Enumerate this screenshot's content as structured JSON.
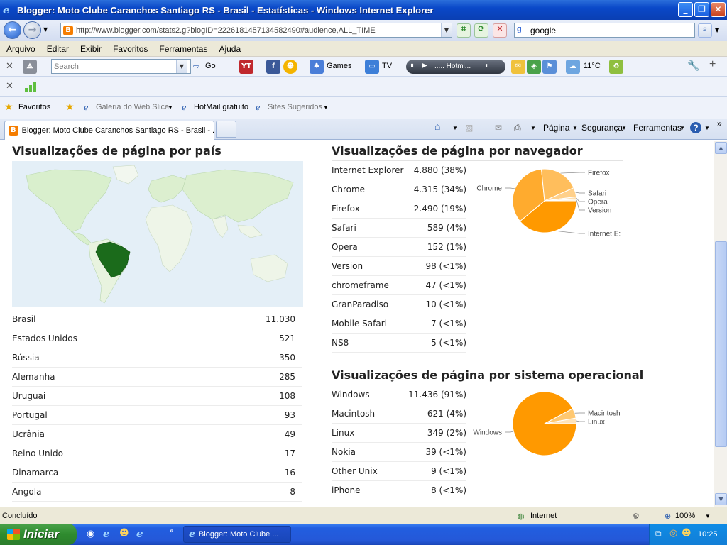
{
  "window": {
    "title": "Blogger: Moto Clube Caranchos Santiago RS - Brasil - Estatísticas - Windows Internet Explorer"
  },
  "address": {
    "url": "http://www.blogger.com/stats2.g?blogID=2226181457134582490#audience,ALL_TIME",
    "search_value": "google"
  },
  "menu": [
    "Arquivo",
    "Editar",
    "Exibir",
    "Favoritos",
    "Ferramentas",
    "Ajuda"
  ],
  "toolbar1": {
    "search_placeholder": "Search",
    "go_label": "Go",
    "games_label": "Games",
    "tv_label": "TV",
    "player_label": "..... Hotmi...",
    "temperature": "11°C"
  },
  "favorites": {
    "favorites_label": "Favoritos",
    "web_slice": "Galeria do Web Slice",
    "hotmail": "HotMail gratuito",
    "suggested": "Sites Sugeridos"
  },
  "tabs": {
    "active_label": "Blogger: Moto Clube Caranchos Santiago RS - Brasil - ..."
  },
  "commands": {
    "page": "Página",
    "security": "Segurança",
    "tools": "Ferramentas"
  },
  "countries": {
    "title": "Visualizações de página por país",
    "rows": [
      {
        "name": "Brasil",
        "value": "11.030"
      },
      {
        "name": "Estados Unidos",
        "value": "521"
      },
      {
        "name": "Rússia",
        "value": "350"
      },
      {
        "name": "Alemanha",
        "value": "285"
      },
      {
        "name": "Uruguai",
        "value": "108"
      },
      {
        "name": "Portugal",
        "value": "93"
      },
      {
        "name": "Ucrânia",
        "value": "49"
      },
      {
        "name": "Reino Unido",
        "value": "17"
      },
      {
        "name": "Dinamarca",
        "value": "16"
      },
      {
        "name": "Angola",
        "value": "8"
      }
    ]
  },
  "browsers": {
    "title": "Visualizações de página por navegador",
    "rows": [
      {
        "name": "Internet Explorer",
        "value": "4.880 (38%)"
      },
      {
        "name": "Chrome",
        "value": "4.315 (34%)"
      },
      {
        "name": "Firefox",
        "value": "2.490 (19%)"
      },
      {
        "name": "Safari",
        "value": "589 (4%)"
      },
      {
        "name": "Opera",
        "value": "152 (1%)"
      },
      {
        "name": "Version",
        "value": "98 (<1%)"
      },
      {
        "name": "chromeframe",
        "value": "47 (<1%)"
      },
      {
        "name": "GranParadiso",
        "value": "10 (<1%)"
      },
      {
        "name": "Mobile Safari",
        "value": "7 (<1%)"
      },
      {
        "name": "NS8",
        "value": "5 (<1%)"
      }
    ]
  },
  "os": {
    "title": "Visualizações de página por sistema operacional",
    "rows": [
      {
        "name": "Windows",
        "value": "11.436 (91%)"
      },
      {
        "name": "Macintosh",
        "value": "621 (4%)"
      },
      {
        "name": "Linux",
        "value": "349 (2%)"
      },
      {
        "name": "Nokia",
        "value": "39 (<1%)"
      },
      {
        "name": "Other Unix",
        "value": "9 (<1%)"
      },
      {
        "name": "iPhone",
        "value": "8 (<1%)"
      }
    ]
  },
  "chart_data": [
    {
      "type": "pie",
      "labels": [
        "Internet E:",
        "Chrome",
        "Firefox",
        "Safari",
        "Opera",
        "Version"
      ],
      "values": [
        4880,
        4315,
        2490,
        589,
        152,
        98
      ],
      "colors": [
        "#ff9900",
        "#ffab2e",
        "#ffbe5c",
        "#ffd08a",
        "#ffe0b0",
        "#ffeccc"
      ]
    },
    {
      "type": "pie",
      "labels": [
        "Windows",
        "Macintosh",
        "Linux"
      ],
      "values": [
        11436,
        621,
        349
      ],
      "colors": [
        "#ff9900",
        "#ffc870",
        "#ffe3b8"
      ]
    }
  ],
  "status": {
    "text": "Concluído",
    "zone": "Internet",
    "zoom": "100%"
  },
  "taskbar": {
    "start_label": "Iniciar",
    "task_label": "Blogger: Moto Clube ...",
    "clock": "10:25"
  }
}
